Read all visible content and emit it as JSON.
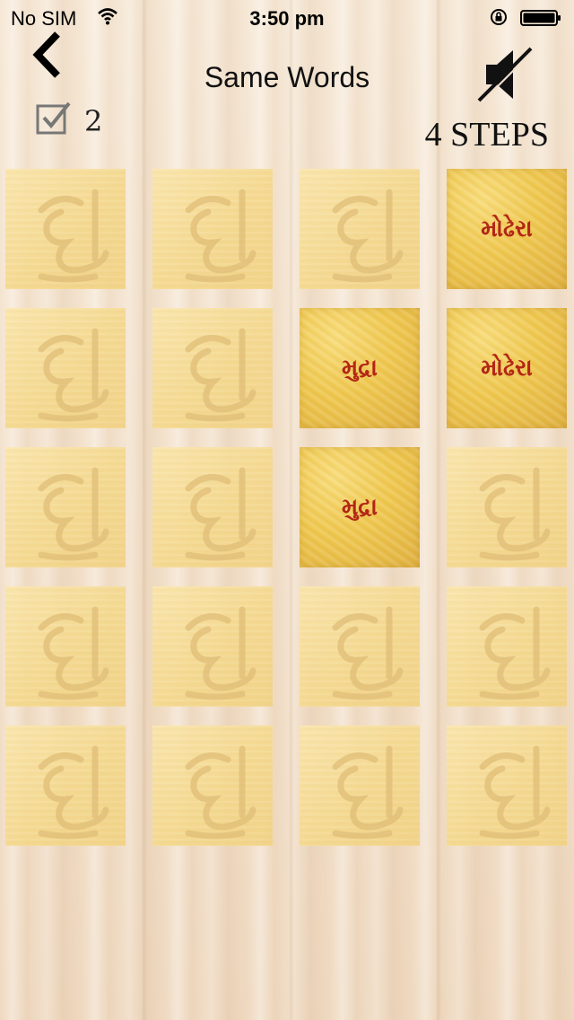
{
  "status_bar": {
    "carrier": "No SIM",
    "time": "3:50 pm"
  },
  "header": {
    "title": "Same Words",
    "back_icon": "chevron-left-icon",
    "sound_icon": "speaker-muted-icon"
  },
  "score": {
    "matches_icon": "checkbox-icon",
    "matches": "2",
    "steps_label": "4 STEPS"
  },
  "colors": {
    "card_back": "#f5d98f",
    "card_face": "#efc850",
    "word_text": "#b32616"
  },
  "board": {
    "rows": 5,
    "cols": 4,
    "cards": [
      {
        "state": "hidden"
      },
      {
        "state": "hidden"
      },
      {
        "state": "hidden"
      },
      {
        "state": "revealed",
        "word": "મોઢેરા"
      },
      {
        "state": "hidden"
      },
      {
        "state": "hidden"
      },
      {
        "state": "revealed",
        "word": "મુદ્રા"
      },
      {
        "state": "revealed",
        "word": "મોઢેરા"
      },
      {
        "state": "hidden"
      },
      {
        "state": "hidden"
      },
      {
        "state": "revealed",
        "word": "મુદ્રા"
      },
      {
        "state": "hidden"
      },
      {
        "state": "hidden"
      },
      {
        "state": "hidden"
      },
      {
        "state": "hidden"
      },
      {
        "state": "hidden"
      },
      {
        "state": "hidden"
      },
      {
        "state": "hidden"
      },
      {
        "state": "hidden"
      },
      {
        "state": "hidden"
      }
    ]
  }
}
